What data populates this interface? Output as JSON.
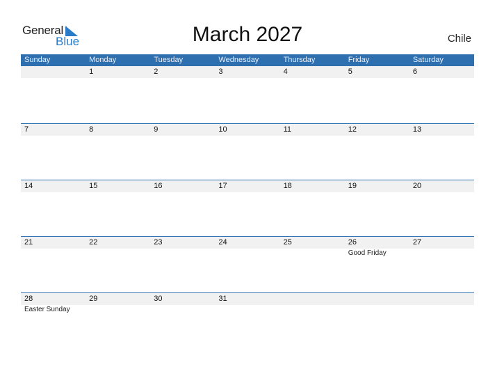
{
  "logo": {
    "general": "General",
    "blue": "Blue",
    "accent_color": "#2a7bc8"
  },
  "header": {
    "title": "March 2027",
    "country": "Chile",
    "header_color": "#2e6fb0"
  },
  "weekdays": [
    "Sunday",
    "Monday",
    "Tuesday",
    "Wednesday",
    "Thursday",
    "Friday",
    "Saturday"
  ],
  "weeks": [
    {
      "days": [
        "",
        "1",
        "2",
        "3",
        "4",
        "5",
        "6"
      ],
      "events": [
        "",
        "",
        "",
        "",
        "",
        "",
        ""
      ]
    },
    {
      "days": [
        "7",
        "8",
        "9",
        "10",
        "11",
        "12",
        "13"
      ],
      "events": [
        "",
        "",
        "",
        "",
        "",
        "",
        ""
      ]
    },
    {
      "days": [
        "14",
        "15",
        "16",
        "17",
        "18",
        "19",
        "20"
      ],
      "events": [
        "",
        "",
        "",
        "",
        "",
        "",
        ""
      ]
    },
    {
      "days": [
        "21",
        "22",
        "23",
        "24",
        "25",
        "26",
        "27"
      ],
      "events": [
        "",
        "",
        "",
        "",
        "",
        "Good Friday",
        ""
      ]
    },
    {
      "days": [
        "28",
        "29",
        "30",
        "31",
        "",
        "",
        ""
      ],
      "events": [
        "Easter Sunday",
        "",
        "",
        "",
        "",
        "",
        ""
      ]
    }
  ]
}
